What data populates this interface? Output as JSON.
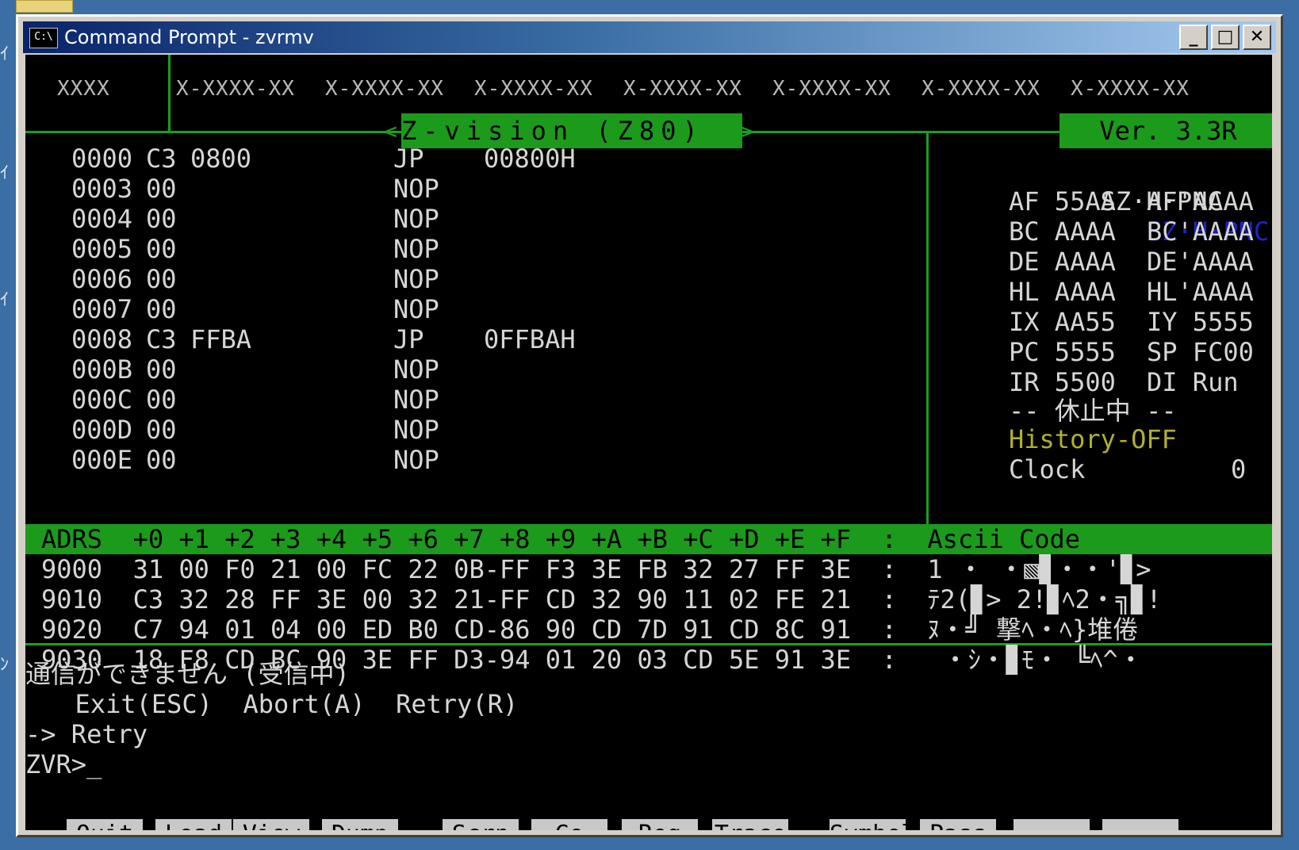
{
  "window": {
    "title": "Command Prompt - zvrmv",
    "icon_text": "C:\\",
    "minimize": "_",
    "maximize": "□",
    "close": "✕"
  },
  "header": {
    "col0": "XXXX",
    "cols": [
      "X-XXXX-XX",
      "X-XXXX-XX",
      "X-XXXX-XX",
      "X-XXXX-XX",
      "X-XXXX-XX",
      "X-XXXX-XX",
      "X-XXXX-XX"
    ]
  },
  "banner": {
    "title": "Z-vision (Z80)",
    "left_arrow": "<",
    "right_arrow": ">",
    "version": "Ver. 3.3R"
  },
  "disasm": [
    {
      "addr": "0000",
      "bytes": "C3",
      "arg": "0800",
      "op": "JP",
      "operand": "00800H"
    },
    {
      "addr": "0003",
      "bytes": "00",
      "arg": "",
      "op": "NOP",
      "operand": ""
    },
    {
      "addr": "0004",
      "bytes": "00",
      "arg": "",
      "op": "NOP",
      "operand": ""
    },
    {
      "addr": "0005",
      "bytes": "00",
      "arg": "",
      "op": "NOP",
      "operand": ""
    },
    {
      "addr": "0006",
      "bytes": "00",
      "arg": "",
      "op": "NOP",
      "operand": ""
    },
    {
      "addr": "0007",
      "bytes": "00",
      "arg": "",
      "op": "NOP",
      "operand": ""
    },
    {
      "addr": "0008",
      "bytes": "C3",
      "arg": "FFBA",
      "op": "JP",
      "operand": "0FFBAH"
    },
    {
      "addr": "000B",
      "bytes": "00",
      "arg": "",
      "op": "NOP",
      "operand": ""
    },
    {
      "addr": "000C",
      "bytes": "00",
      "arg": "",
      "op": "NOP",
      "operand": ""
    },
    {
      "addr": "000D",
      "bytes": "00",
      "arg": "",
      "op": "NOP",
      "operand": ""
    },
    {
      "addr": "000E",
      "bytes": "00",
      "arg": "",
      "op": "NOP",
      "operand": ""
    }
  ],
  "registers": {
    "flags_a": "SZ·H·PNC",
    "flags_b": "SZ·H·PNC",
    "rows": [
      [
        "AF 55AA",
        "AF'AAAA"
      ],
      [
        "BC AAAA",
        "BC'AAAA"
      ],
      [
        "DE AAAA",
        "DE'AAAA"
      ],
      [
        "HL AAAA",
        "HL'AAAA"
      ],
      [
        "IX AA55",
        "IY 5555"
      ],
      [
        "PC 5555",
        "SP FC00"
      ],
      [
        "IR 5500",
        "DI Run"
      ]
    ],
    "status": "-- 休止中 --",
    "history": "History-OFF",
    "clock_label": "Clock",
    "clock_value": "0"
  },
  "dump": {
    "header": "ADRS  +0 +1 +2 +3 +4 +5 +6 +7 +8 +9 +A +B +C +D +E +F  :  Ascii Code",
    "rows": [
      "9000  31 00 F0 21 00 FC 22 0B-FF F3 3E FB 32 27 FF 3E  :  1 ・ ・▧▊・・'▊>",
      "9010  C3 32 28 FF 3E 00 32 21-FF CD 32 90 11 02 FE 21  :  ﾃ2(▊> 2!▊ﾍ2・╗▊!",
      "9020  C7 94 01 04 00 ED B0 CD-86 90 CD 7D 91 CD 8C 91  :  ﾇ・╝ 撃ﾍ・ﾍ}堆倦",
      "9030  18 F8 CD BC 90 3E FF D3-94 01 20 03 CD 5E 91 3E  :   ・ｼ・▊ﾓ・ ╚ﾍ^・"
    ]
  },
  "console": {
    "error": "通信ができません (受信中)",
    "options": "  Exit(ESC)  Abort(A)  Retry(R)",
    "choice": "-> Retry",
    "prompt": "ZVR>_"
  },
  "fkeys": [
    "Quit",
    "Load",
    "View",
    "Dump",
    "Scrn",
    "Go",
    "Reg",
    "Trace",
    "Symbol",
    "Pass",
    "",
    ""
  ]
}
